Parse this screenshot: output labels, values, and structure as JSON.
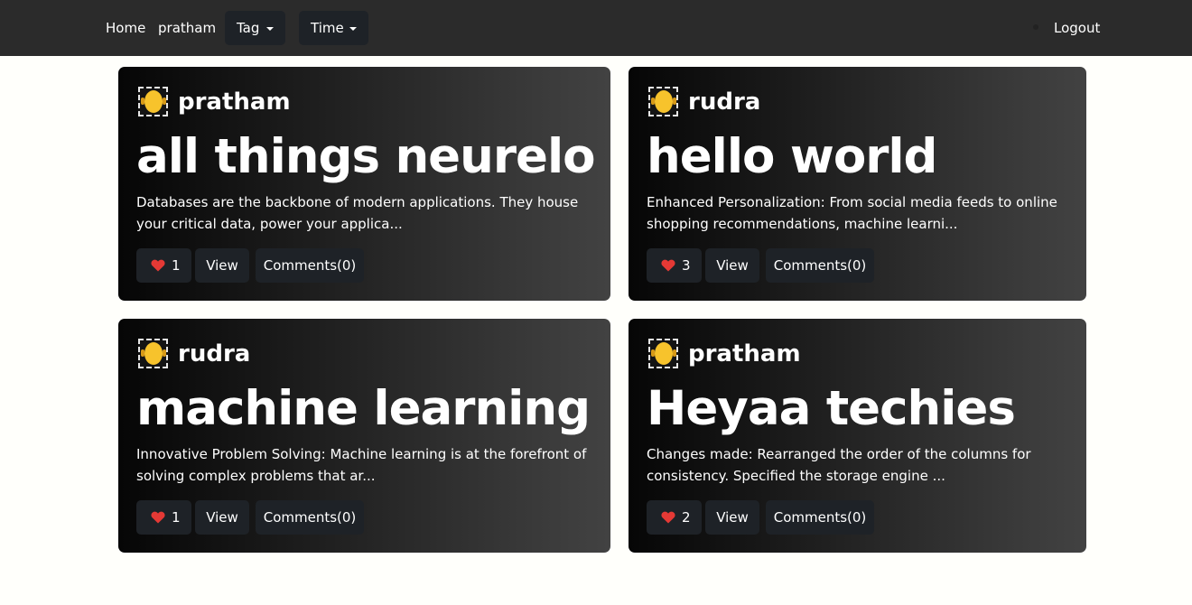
{
  "navbar": {
    "home": "Home",
    "user": "pratham",
    "tag_dropdown": "Tag",
    "time_dropdown": "Time",
    "logout": "Logout"
  },
  "posts": [
    {
      "author": "pratham",
      "title": "all things neurelo",
      "excerpt": "Databases are the backbone of modern applications. They house your critical data, power your applica...",
      "likes": "1",
      "view_label": "View",
      "comments_label": "Comments(0)"
    },
    {
      "author": "rudra",
      "title": "hello world",
      "excerpt": "Enhanced Personalization: From social media feeds to online shopping recommendations, machine learni...",
      "likes": "3",
      "view_label": "View",
      "comments_label": "Comments(0)"
    },
    {
      "author": "rudra",
      "title": "machine learning",
      "excerpt": "Innovative Problem Solving: Machine learning is at the forefront of solving complex problems that ar...",
      "likes": "1",
      "view_label": "View",
      "comments_label": "Comments(0)"
    },
    {
      "author": "pratham",
      "title": "Heyaa techies",
      "excerpt": "Changes made: Rearranged the order of the columns for consistency. Specified the storage engine ...",
      "likes": "2",
      "view_label": "View",
      "comments_label": "Comments(0)"
    }
  ],
  "icons": {
    "like": "heart-icon",
    "avatar": "avatar-icon",
    "dropdown": "caret-down-icon"
  },
  "colors": {
    "navbar_bg": "#2b2b2b",
    "button_bg": "#1e2227",
    "heart": "#e53935",
    "avatar": "#f7c32c",
    "page_bg": "#fffffb"
  }
}
